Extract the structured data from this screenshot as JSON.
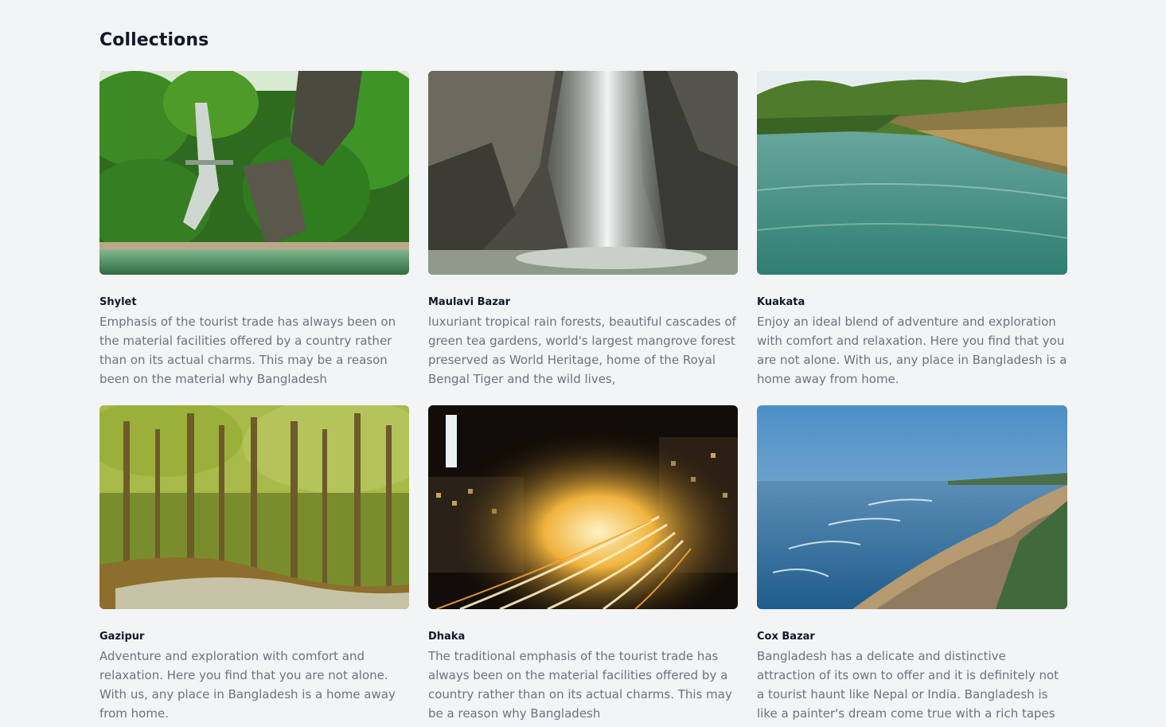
{
  "section": {
    "title": "Collections"
  },
  "collections": [
    {
      "name": "Shylet",
      "description": "Emphasis of the tourist trade has always been on the material facilities offered by a country rather than on its actual charms. This may be a reason been on the material why Bangladesh",
      "image_icon": "waterfall-forest-image"
    },
    {
      "name": "Maulavi Bazar",
      "description": "luxuriant tropical rain forests, beautiful cascades of green tea gardens, world's largest mangrove forest preserved as World Heritage, home of the Royal Bengal Tiger and the wild lives,",
      "image_icon": "waterfall-rock-image"
    },
    {
      "name": "Kuakata",
      "description": "Enjoy an ideal blend of adventure and exploration with comfort and relaxation. Here you find that you are not alone. With us, any place in Bangladesh is a home away from home.",
      "image_icon": "river-mangrove-image"
    },
    {
      "name": "Gazipur",
      "description": "Adventure and exploration with comfort and relaxation. Here you find that you are not alone. With us, any place in Bangladesh is a home away from home.",
      "image_icon": "forest-path-image"
    },
    {
      "name": "Dhaka",
      "description": "The traditional emphasis of the tourist trade has always been on the material facilities offered by a country rather than on its actual charms. This may be a reason why Bangladesh",
      "image_icon": "city-night-traffic-image"
    },
    {
      "name": "Cox Bazar",
      "description": "Bangladesh has a delicate and distinctive attraction of its own to offer and it is definitely not a tourist haunt like Nepal or India. Bangladesh is like a painter's dream come true with a rich tapes",
      "image_icon": "beach-coast-image"
    }
  ]
}
